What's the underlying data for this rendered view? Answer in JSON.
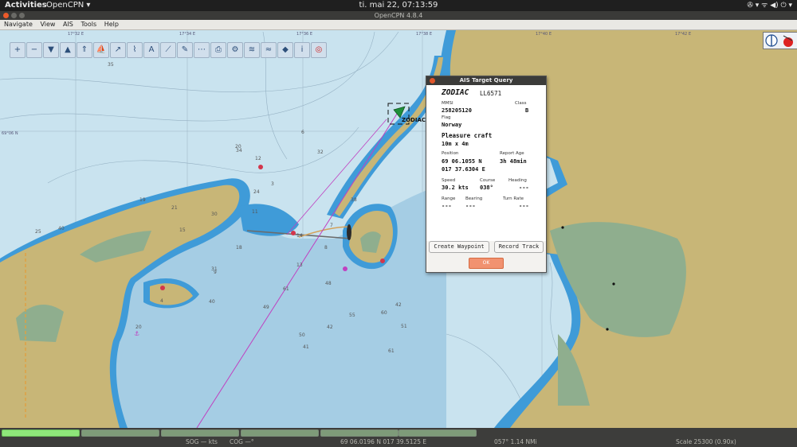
{
  "topbar": {
    "activities": "Activities",
    "app_menu": "OpenCPN ▾",
    "clock": "ti. mai 22, 07:13:59",
    "tray": "✇ ▾    ᯤ ◀) ⏻ ▾"
  },
  "window": {
    "title": "OpenCPN 4.8.4"
  },
  "menu": {
    "items": [
      "Navigate",
      "View",
      "AIS",
      "Tools",
      "Help"
    ]
  },
  "toolbar": {
    "icons": [
      "zoom-in-icon",
      "zoom-out-icon",
      "scale-in-icon",
      "scale-out-icon",
      "chart-up-icon",
      "ship-icon",
      "follow-icon",
      "route-icon",
      "text-icon",
      "measure-icon",
      "note-icon",
      "track-icon",
      "print-icon",
      "settings-icon",
      "layers-icon",
      "tide-icon",
      "ais-icon",
      "info-icon",
      "mob-icon"
    ]
  },
  "map": {
    "lat_label": "69°06 N",
    "lon_labels": [
      "17°32 E",
      "17°34 E",
      "17°36 E",
      "17°38 E",
      "17°40 E",
      "17°42 E"
    ],
    "target_label": "ZODIAC",
    "depths": [
      "35",
      "20",
      "12",
      "6",
      "3",
      "15",
      "40",
      "25",
      "19",
      "21",
      "7",
      "55",
      "13",
      "14",
      "48",
      "31",
      "61",
      "40",
      "49",
      "50",
      "42",
      "60",
      "51",
      "42",
      "18",
      "30",
      "4",
      "9",
      "24",
      "11",
      "34",
      "32",
      "38",
      "8",
      "20",
      "61",
      "41"
    ]
  },
  "ais_dialog": {
    "title": "AIS Target Query",
    "name": "ZODIAC",
    "callsign": "LL6571",
    "mmsi_label": "MMSI",
    "mmsi": "258205120",
    "class_label": "Class",
    "class": "B",
    "flag_label": "Flag",
    "flag": "Norway",
    "type": "Pleasure craft",
    "size": "10m x 4m",
    "position_label": "Position",
    "lat": "69 06.1055 N",
    "lon": "017 37.6304 E",
    "report_age_label": "Report Age",
    "report_age": "3h 48min",
    "speed_label": "Speed",
    "speed": "30.2 kts",
    "course_label": "Course",
    "course": "038°",
    "heading_label": "Heading",
    "heading": "---",
    "range_label": "Range",
    "range": "---",
    "bearing_label": "Bearing",
    "bearing": "---",
    "turn_label": "Turn Rate",
    "turn": "---",
    "btn_waypoint": "Create Waypoint",
    "btn_track": "Record Track",
    "btn_ok": "OK"
  },
  "status": {
    "sog": "SOG — kts",
    "cog": "COG —°",
    "cursor": "69 06.0196 N  017 39.5125 E",
    "brg": "057°  1.14 NMi",
    "scale": "Scale 25300 (0.90x)"
  },
  "colors": {
    "land": "#c8b677",
    "shallow": "#4aa0dc",
    "mid": "#a5cde4",
    "deep": "#c9e3ef",
    "drying": "#8fae8e",
    "route": "#c040c0"
  }
}
